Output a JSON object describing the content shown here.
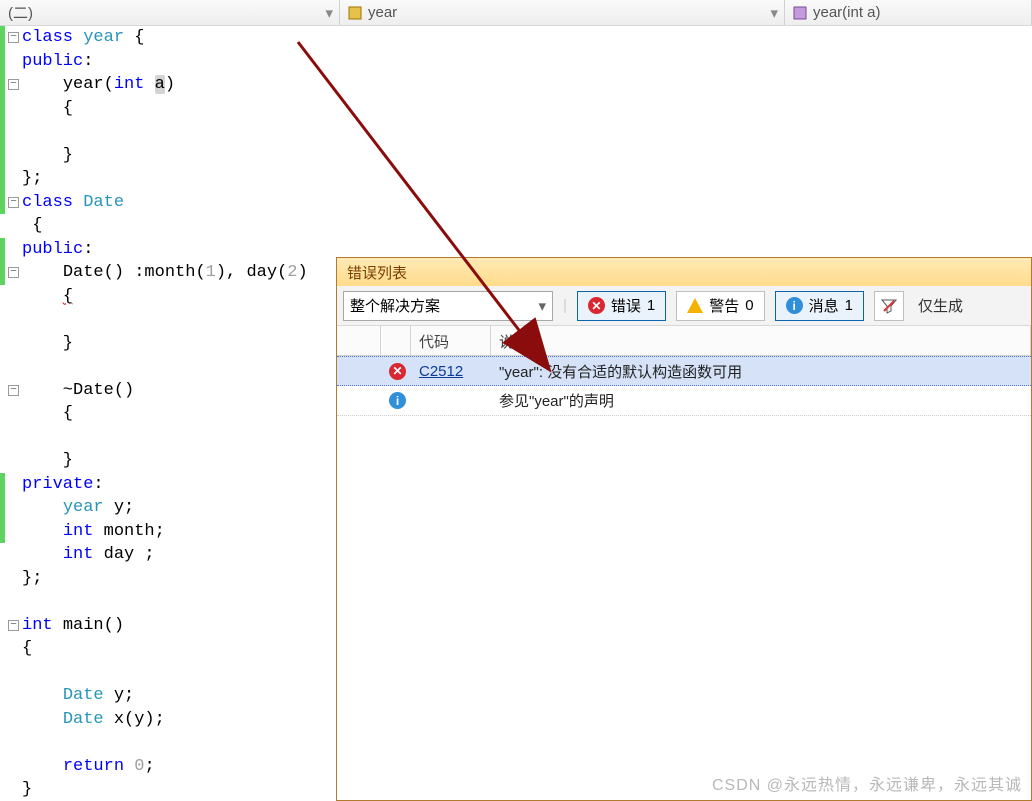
{
  "crumbs": {
    "scope": "(二)",
    "class": "year",
    "member": "year(int a)"
  },
  "code": {
    "lines": [
      {
        "frag": [
          {
            "t": "class ",
            "c": "kw"
          },
          {
            "t": "year",
            "c": "type"
          },
          {
            "t": " {"
          }
        ]
      },
      {
        "frag": [
          {
            "t": "public",
            "c": "kw"
          },
          {
            "t": ":"
          }
        ]
      },
      {
        "frag": [
          {
            "t": "    "
          },
          {
            "t": "year",
            "c": ""
          },
          {
            "t": "("
          },
          {
            "t": "int ",
            "c": "kw"
          },
          {
            "t": "a",
            "c": "param-hl"
          },
          {
            "t": ")"
          }
        ],
        "current": true
      },
      {
        "frag": [
          {
            "t": "    {"
          }
        ]
      },
      {
        "frag": [
          {
            "t": ""
          }
        ]
      },
      {
        "frag": [
          {
            "t": "    }"
          }
        ]
      },
      {
        "frag": [
          {
            "t": "};"
          }
        ]
      },
      {
        "frag": [
          {
            "t": "class ",
            "c": "kw"
          },
          {
            "t": "Date",
            "c": "type"
          }
        ]
      },
      {
        "frag": [
          {
            "t": " {"
          }
        ]
      },
      {
        "frag": [
          {
            "t": "public",
            "c": "kw"
          },
          {
            "t": ":"
          }
        ]
      },
      {
        "frag": [
          {
            "t": "    "
          },
          {
            "t": "Date",
            "c": ""
          },
          {
            "t": "() :month("
          },
          {
            "t": "1",
            "c": "num"
          },
          {
            "t": "), day("
          },
          {
            "t": "2",
            "c": "num"
          },
          {
            "t": ")"
          }
        ]
      },
      {
        "frag": [
          {
            "t": "    "
          },
          {
            "t": "{",
            "c": "squiggle"
          }
        ]
      },
      {
        "frag": [
          {
            "t": ""
          }
        ]
      },
      {
        "frag": [
          {
            "t": "    }"
          }
        ]
      },
      {
        "frag": [
          {
            "t": ""
          }
        ]
      },
      {
        "frag": [
          {
            "t": "    ~"
          },
          {
            "t": "Date",
            "c": ""
          },
          {
            "t": "()"
          }
        ]
      },
      {
        "frag": [
          {
            "t": "    {"
          }
        ]
      },
      {
        "frag": [
          {
            "t": ""
          }
        ]
      },
      {
        "frag": [
          {
            "t": "    }"
          }
        ]
      },
      {
        "frag": [
          {
            "t": "private",
            "c": "kw"
          },
          {
            "t": ":"
          }
        ]
      },
      {
        "frag": [
          {
            "t": "    "
          },
          {
            "t": "year",
            "c": "type"
          },
          {
            "t": " y;"
          }
        ]
      },
      {
        "frag": [
          {
            "t": "    "
          },
          {
            "t": "int",
            "c": "kw"
          },
          {
            "t": " month;"
          }
        ]
      },
      {
        "frag": [
          {
            "t": "    "
          },
          {
            "t": "int",
            "c": "kw"
          },
          {
            "t": " day ;"
          }
        ]
      },
      {
        "frag": [
          {
            "t": "};"
          }
        ]
      },
      {
        "frag": [
          {
            "t": ""
          }
        ]
      },
      {
        "frag": [
          {
            "t": "int ",
            "c": "kw"
          },
          {
            "t": "main()"
          }
        ]
      },
      {
        "frag": [
          {
            "t": "{"
          }
        ]
      },
      {
        "frag": [
          {
            "t": ""
          }
        ]
      },
      {
        "frag": [
          {
            "t": "    "
          },
          {
            "t": "Date",
            "c": "type"
          },
          {
            "t": " y;"
          }
        ]
      },
      {
        "frag": [
          {
            "t": "    "
          },
          {
            "t": "Date",
            "c": "type"
          },
          {
            "t": " x(y);"
          }
        ]
      },
      {
        "frag": [
          {
            "t": ""
          }
        ]
      },
      {
        "frag": [
          {
            "t": "    "
          },
          {
            "t": "return ",
            "c": "kw"
          },
          {
            "t": "0",
            "c": "num"
          },
          {
            "t": ";"
          }
        ]
      },
      {
        "frag": [
          {
            "t": "}"
          }
        ]
      }
    ],
    "folds": [
      0,
      2,
      7,
      10,
      15,
      25
    ],
    "changebars": [
      [
        0,
        7
      ],
      [
        9,
        10
      ],
      [
        19,
        21
      ]
    ]
  },
  "error_panel": {
    "title": "错误列表",
    "scope_combo": "整个解决方案",
    "buttons": {
      "errors": {
        "label": "错误",
        "count": 1
      },
      "warnings": {
        "label": "警告",
        "count": 0
      },
      "messages": {
        "label": "消息",
        "count": 1
      }
    },
    "last_filter": "仅生成",
    "columns": {
      "code": "代码",
      "desc": "说明"
    },
    "rows": [
      {
        "kind": "error",
        "code": "C2512",
        "desc": "\"year\": 没有合适的默认构造函数可用",
        "selected": true
      },
      {
        "kind": "info",
        "code": "",
        "desc": "参见\"year\"的声明",
        "selected": false
      }
    ]
  },
  "watermark": "CSDN @永远热情，永远谦卑，永远其诚"
}
